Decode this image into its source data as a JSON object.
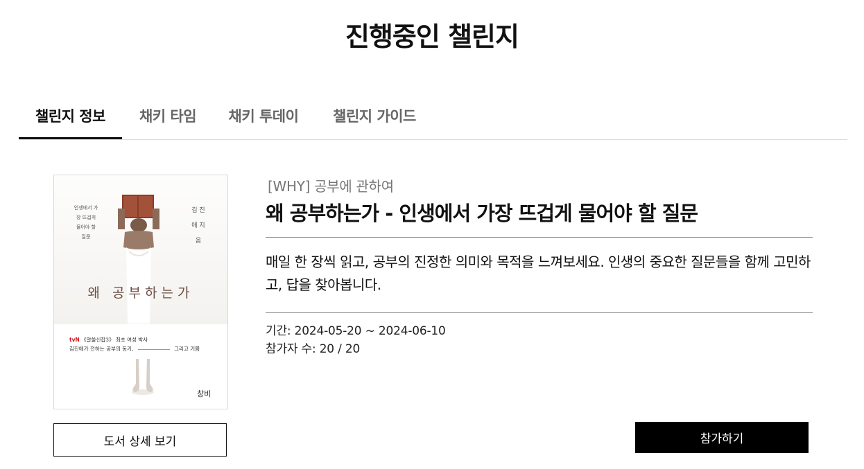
{
  "page": {
    "title": "진행중인 챌린지"
  },
  "tabs": [
    {
      "label": "챌린지 정보",
      "active": true
    },
    {
      "label": "채키 타임",
      "active": false
    },
    {
      "label": "채키 투데이",
      "active": false
    },
    {
      "label": "챌린지 가이드",
      "active": false
    }
  ],
  "book": {
    "cover": {
      "side_text": "인생에서 가장 뜨겁게 물어야 할 질문",
      "author_text": "김 진 애 지음",
      "title": "왜 공부하는가",
      "tag_brand": "tvN",
      "tag_line1": "《알쓸신잡3》 최초 여성 박사",
      "tag_line2": "김진애가 전하는 공부의 동기,",
      "tag_line3": "그리고 기쁨",
      "publisher_mark": "창비"
    },
    "category": "[WHY] 공부에 관하여",
    "title": "왜 공부하는가 - 인생에서 가장 뜨겁게 물어야 할 질문",
    "description": "매일 한 장씩 읽고, 공부의 진정한 의미와 목적을 느껴보세요. 인생의 중요한 질문들을 함께 고민하고, 답을 찾아봅니다.",
    "period": "기간: 2024-05-20 ~ 2024-06-10",
    "participants": "참가자 수: 20 / 20"
  },
  "buttons": {
    "detail_label": "도서 상세 보기",
    "join_label": "참가하기"
  },
  "colors": {
    "accent": "#000000",
    "cover_title": "#6b4d44",
    "brand_red": "#d0121b"
  }
}
